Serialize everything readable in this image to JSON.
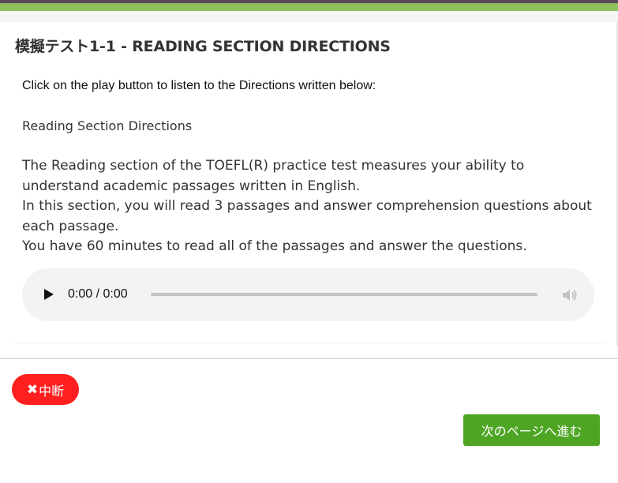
{
  "header": {
    "title": "模擬テスト1-1 - READING SECTION DIRECTIONS"
  },
  "content": {
    "instruction": "Click on the play button to listen to the Directions written below:",
    "section_heading": "Reading Section Directions",
    "paragraph_lines": [
      "The Reading section of the TOEFL(R) practice test measures your ability to",
      "understand academic passages written in English.",
      "In this section, you will read 3 passages and answer comprehension questions about",
      "each passage.",
      "You have 60 minutes to read all of the passages and answer the questions."
    ]
  },
  "audio_player": {
    "time_display": "0:00 / 0:00",
    "progress": 0,
    "play_icon": "play-icon",
    "volume_icon": "volume-icon"
  },
  "footer": {
    "abort_icon": "✖",
    "abort_label": "中断",
    "next_label": "次のページへ進む"
  },
  "colors": {
    "top_bar": "#8dc15c",
    "abort_button": "#ff1f1f",
    "next_button": "#4ea524",
    "audio_background": "#f1f3f4"
  }
}
